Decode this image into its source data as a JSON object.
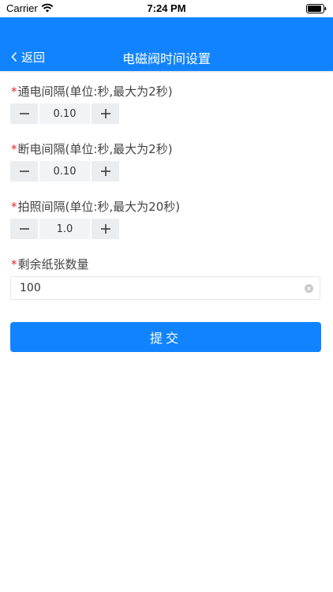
{
  "status_bar": {
    "carrier": "Carrier",
    "time": "7:24 PM"
  },
  "nav": {
    "back_label": "返回",
    "title": "电磁阀时间设置"
  },
  "form": {
    "required_mark": "*",
    "fields": [
      {
        "label": "通电间隔(单位:秒,最大为2秒)",
        "value": "0.10"
      },
      {
        "label": "断电间隔(单位:秒,最大为2秒)",
        "value": "0.10"
      },
      {
        "label": "拍照间隔(单位:秒,最大为20秒)",
        "value": "1.0"
      }
    ],
    "paper_count": {
      "label": "剩余纸张数量",
      "value": "100"
    },
    "submit_label": "提交"
  },
  "colors": {
    "primary": "#1283ff",
    "required": "#e0282a",
    "stepper_button_bg": "#ebedf0",
    "stepper_value_bg": "#f2f3f5"
  }
}
